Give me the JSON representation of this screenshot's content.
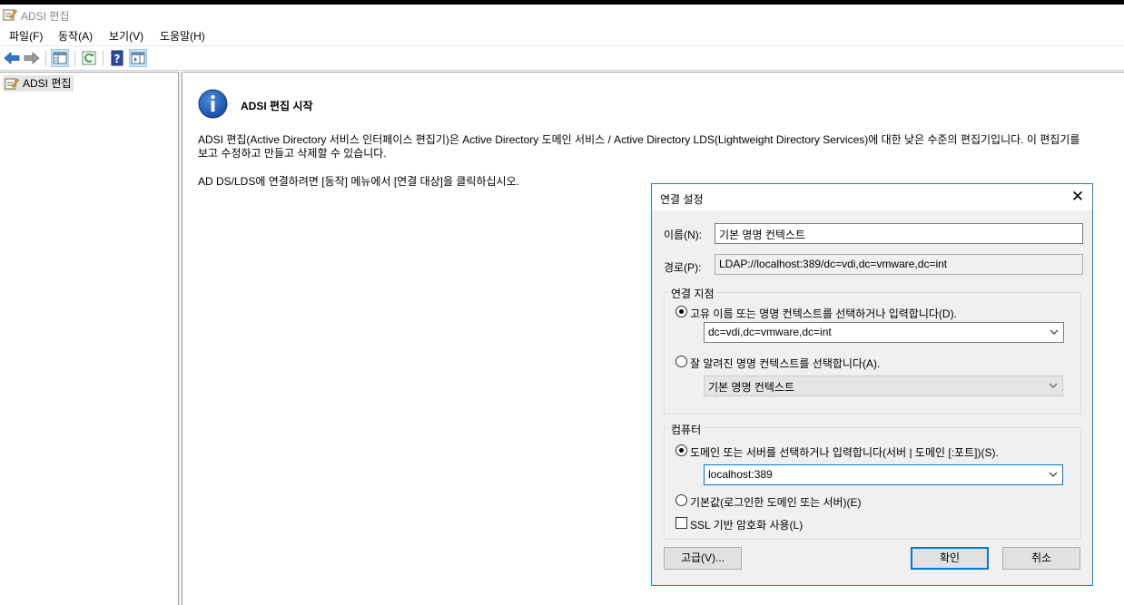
{
  "window": {
    "title": "ADSI 편집"
  },
  "menu": [
    "파일(F)",
    "동작(A)",
    "보기(V)",
    "도움말(H)"
  ],
  "tree": {
    "root_label": "ADSI 편집"
  },
  "main": {
    "heading": "ADSI 편집 시작",
    "para_line1": "ADSI 편집(Active Directory 서비스 인터페이스 편집기)은 Active Directory 도메인 서비스 / Active Directory LDS(Lightweight Directory Services)에 대한 낮은 수준의 편집기입니다. 이 편집기를",
    "para_line2": "보고 수정하고 만들고 삭제할 수 있습니다.",
    "para2": "AD DS/LDS에 연결하려면 [동작] 메뉴에서 [연결 대상]을 클릭하십시오."
  },
  "dialog": {
    "title": "연결 설정",
    "close_glyph": "✕",
    "name_label": "이름(N):",
    "name_value": "기본 명명 컨텍스트",
    "path_label": "경로(P):",
    "path_value": "LDAP://localhost:389/dc=vdi,dc=vmware,dc=int",
    "connection_point": {
      "group_label": "연결 지점",
      "option1_label": "고유 이름 또는 명명 컨텍스트를 선택하거나 입력합니다(D).",
      "option1_value": "dc=vdi,dc=vmware,dc=int",
      "option2_label": "잘 알려진 명명 컨텍스트를 선택합니다(A).",
      "option2_value": "기본 명명 컨텍스트"
    },
    "computer": {
      "group_label": "컴퓨터",
      "option1_label": "도메인 또는 서버를 선택하거나 입력합니다(서버 | 도메인 [:포트])(S).",
      "option1_value": "localhost:389",
      "option2_label": "기본값(로그인한 도메인 또는 서버)(E)",
      "ssl_label": "SSL 기반 암호화 사용(L)"
    },
    "buttons": {
      "advanced": "고급(V)...",
      "ok": "확인",
      "cancel": "취소"
    }
  }
}
